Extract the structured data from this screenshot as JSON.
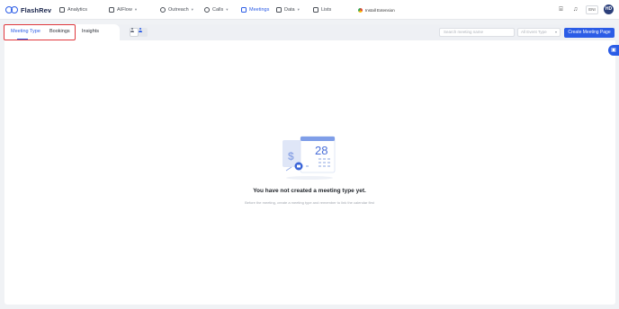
{
  "brand": {
    "name": "FlashRev"
  },
  "nav": {
    "items": [
      {
        "label": "Analytics",
        "icon": "analytics-icon",
        "has_caret": false,
        "active": false
      },
      {
        "label": "AIFlow",
        "icon": "aiflow-icon",
        "has_caret": true,
        "active": false
      },
      {
        "label": "Outreach",
        "icon": "outreach-icon",
        "has_caret": true,
        "active": false
      },
      {
        "label": "Calls",
        "icon": "phone-icon",
        "has_caret": true,
        "active": false
      },
      {
        "label": "Meetings",
        "icon": "meetings-icon",
        "has_caret": false,
        "active": true
      },
      {
        "label": "Data",
        "icon": "data-icon",
        "has_caret": true,
        "active": false
      },
      {
        "label": "Lists",
        "icon": "lists-icon",
        "has_caret": false,
        "active": false
      }
    ],
    "extension_label": "Install Extension",
    "language_label": "ENI",
    "avatar_initials": "HD"
  },
  "tabs": [
    {
      "label": "Meeting Type",
      "active": true
    },
    {
      "label": "Bookings",
      "active": false
    },
    {
      "label": "Insights",
      "active": false
    }
  ],
  "toolbar": {
    "search_placeholder": "Search meeting name",
    "event_type_placeholder": "All Event Type",
    "create_button": "Create Meeting Page"
  },
  "empty_state": {
    "calendar_day": "28",
    "title": "You have not created a meeting type yet.",
    "subtitle": "Before the meeting, create a meeting type and remember to link the calendar first"
  },
  "colors": {
    "accent": "#2b5ce6",
    "highlight_border": "#e0393e",
    "avatar_bg": "#2b3f7a"
  }
}
